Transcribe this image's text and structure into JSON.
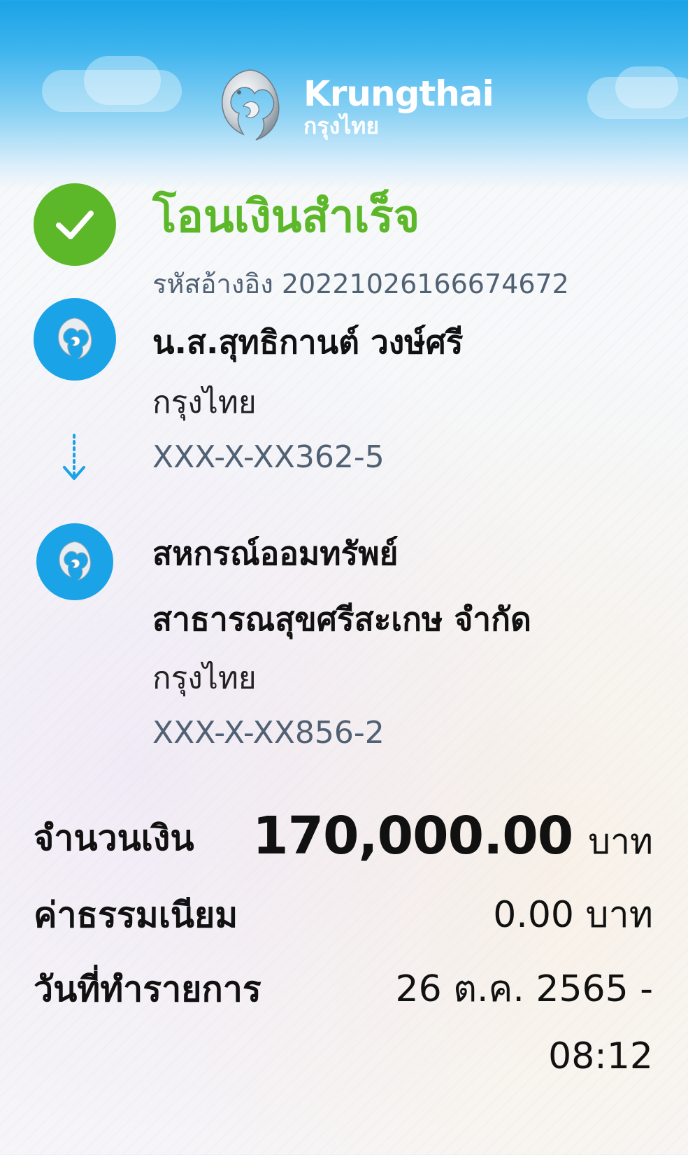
{
  "header": {
    "brand_en": "Krungthai",
    "brand_th": "กรุงไทย"
  },
  "status": {
    "title": "โอนเงินสำเร็จ",
    "ref_label": "รหัสอ้างอิง",
    "ref_value": "2022102616667467​2",
    "color": "#5cb829"
  },
  "sender": {
    "name": "น.ส.สุทธิกานต์ วงษ์ศรี",
    "bank": "กรุงไทย",
    "account": "XXX-X-XX362-5"
  },
  "receiver": {
    "name_line1": "สหกรณ์ออมทรัพย์",
    "name_line2": "สาธารณสุขศรีสะเกษ จำกัด",
    "bank": "กรุงไทย",
    "account": "XXX-X-XX856-2"
  },
  "details": {
    "amount_label": "จำนวนเงิน",
    "amount_value": "170,000.00",
    "amount_unit": "บาท",
    "fee_label": "ค่าธรรมเนียม",
    "fee_value": "0.00 บาท",
    "date_label": "วันที่ทำรายการ",
    "date_value": "26 ต.ค. 2565 -",
    "time_value": "08:12"
  },
  "colors": {
    "brand_blue": "#1aa3e6",
    "success_green": "#5cb829",
    "muted_text": "#516174"
  }
}
